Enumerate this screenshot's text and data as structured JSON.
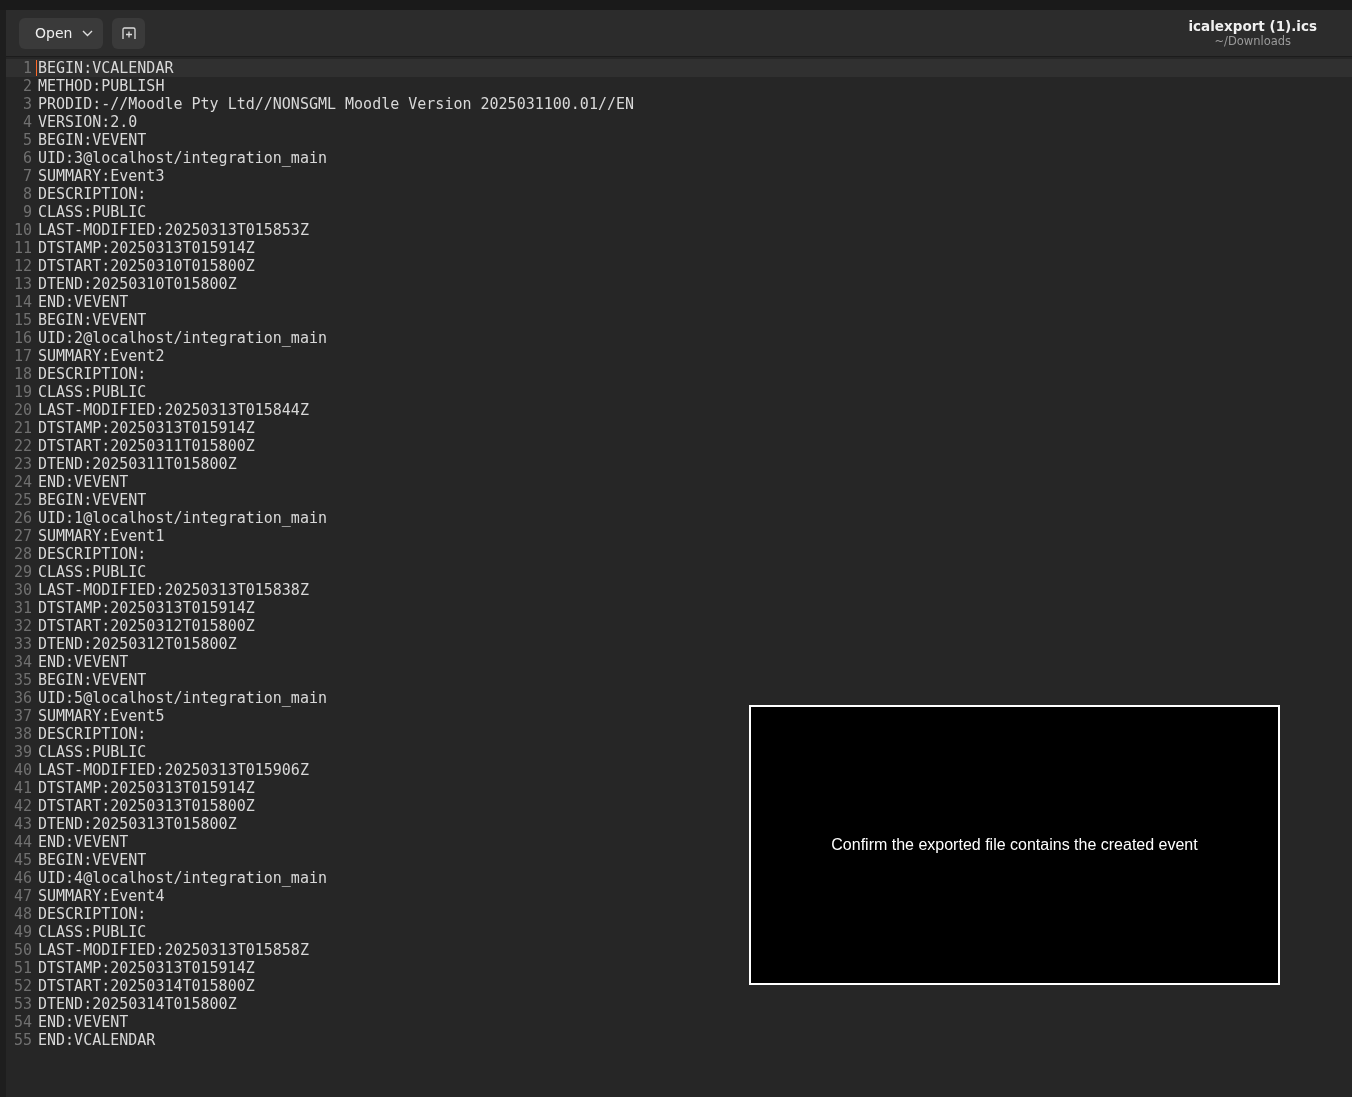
{
  "toolbar": {
    "open_button": "Open"
  },
  "window": {
    "title": "icalexport (1).ics",
    "subtitle": "~/Downloads"
  },
  "editor": {
    "lines": [
      {
        "number": "1",
        "text": "BEGIN:VCALENDAR",
        "selected": true
      },
      {
        "number": "2",
        "text": "METHOD:PUBLISH",
        "selected": false
      },
      {
        "number": "3",
        "text": "PRODID:-//Moodle Pty Ltd//NONSGML Moodle Version 2025031100.01//EN",
        "selected": false
      },
      {
        "number": "4",
        "text": "VERSION:2.0",
        "selected": false
      },
      {
        "number": "5",
        "text": "BEGIN:VEVENT",
        "selected": false
      },
      {
        "number": "6",
        "text": "UID:3@localhost/integration_main",
        "selected": false
      },
      {
        "number": "7",
        "text": "SUMMARY:Event3",
        "selected": false
      },
      {
        "number": "8",
        "text": "DESCRIPTION:",
        "selected": false
      },
      {
        "number": "9",
        "text": "CLASS:PUBLIC",
        "selected": false
      },
      {
        "number": "10",
        "text": "LAST-MODIFIED:20250313T015853Z",
        "selected": false
      },
      {
        "number": "11",
        "text": "DTSTAMP:20250313T015914Z",
        "selected": false
      },
      {
        "number": "12",
        "text": "DTSTART:20250310T015800Z",
        "selected": false
      },
      {
        "number": "13",
        "text": "DTEND:20250310T015800Z",
        "selected": false
      },
      {
        "number": "14",
        "text": "END:VEVENT",
        "selected": false
      },
      {
        "number": "15",
        "text": "BEGIN:VEVENT",
        "selected": false
      },
      {
        "number": "16",
        "text": "UID:2@localhost/integration_main",
        "selected": false
      },
      {
        "number": "17",
        "text": "SUMMARY:Event2",
        "selected": false
      },
      {
        "number": "18",
        "text": "DESCRIPTION:",
        "selected": false
      },
      {
        "number": "19",
        "text": "CLASS:PUBLIC",
        "selected": false
      },
      {
        "number": "20",
        "text": "LAST-MODIFIED:20250313T015844Z",
        "selected": false
      },
      {
        "number": "21",
        "text": "DTSTAMP:20250313T015914Z",
        "selected": false
      },
      {
        "number": "22",
        "text": "DTSTART:20250311T015800Z",
        "selected": false
      },
      {
        "number": "23",
        "text": "DTEND:20250311T015800Z",
        "selected": false
      },
      {
        "number": "24",
        "text": "END:VEVENT",
        "selected": false
      },
      {
        "number": "25",
        "text": "BEGIN:VEVENT",
        "selected": false
      },
      {
        "number": "26",
        "text": "UID:1@localhost/integration_main",
        "selected": false
      },
      {
        "number": "27",
        "text": "SUMMARY:Event1",
        "selected": false
      },
      {
        "number": "28",
        "text": "DESCRIPTION:",
        "selected": false
      },
      {
        "number": "29",
        "text": "CLASS:PUBLIC",
        "selected": false
      },
      {
        "number": "30",
        "text": "LAST-MODIFIED:20250313T015838Z",
        "selected": false
      },
      {
        "number": "31",
        "text": "DTSTAMP:20250313T015914Z",
        "selected": false
      },
      {
        "number": "32",
        "text": "DTSTART:20250312T015800Z",
        "selected": false
      },
      {
        "number": "33",
        "text": "DTEND:20250312T015800Z",
        "selected": false
      },
      {
        "number": "34",
        "text": "END:VEVENT",
        "selected": false
      },
      {
        "number": "35",
        "text": "BEGIN:VEVENT",
        "selected": false
      },
      {
        "number": "36",
        "text": "UID:5@localhost/integration_main",
        "selected": false
      },
      {
        "number": "37",
        "text": "SUMMARY:Event5",
        "selected": false
      },
      {
        "number": "38",
        "text": "DESCRIPTION:",
        "selected": false
      },
      {
        "number": "39",
        "text": "CLASS:PUBLIC",
        "selected": false
      },
      {
        "number": "40",
        "text": "LAST-MODIFIED:20250313T015906Z",
        "selected": false
      },
      {
        "number": "41",
        "text": "DTSTAMP:20250313T015914Z",
        "selected": false
      },
      {
        "number": "42",
        "text": "DTSTART:20250313T015800Z",
        "selected": false
      },
      {
        "number": "43",
        "text": "DTEND:20250313T015800Z",
        "selected": false
      },
      {
        "number": "44",
        "text": "END:VEVENT",
        "selected": false
      },
      {
        "number": "45",
        "text": "BEGIN:VEVENT",
        "selected": false
      },
      {
        "number": "46",
        "text": "UID:4@localhost/integration_main",
        "selected": false
      },
      {
        "number": "47",
        "text": "SUMMARY:Event4",
        "selected": false
      },
      {
        "number": "48",
        "text": "DESCRIPTION:",
        "selected": false
      },
      {
        "number": "49",
        "text": "CLASS:PUBLIC",
        "selected": false
      },
      {
        "number": "50",
        "text": "LAST-MODIFIED:20250313T015858Z",
        "selected": false
      },
      {
        "number": "51",
        "text": "DTSTAMP:20250313T015914Z",
        "selected": false
      },
      {
        "number": "52",
        "text": "DTSTART:20250314T015800Z",
        "selected": false
      },
      {
        "number": "53",
        "text": "DTEND:20250314T015800Z",
        "selected": false
      },
      {
        "number": "54",
        "text": "END:VEVENT",
        "selected": false
      },
      {
        "number": "55",
        "text": "END:VCALENDAR",
        "selected": false
      }
    ]
  },
  "overlay": {
    "caption": "Confirm the exported file contains the created event"
  }
}
